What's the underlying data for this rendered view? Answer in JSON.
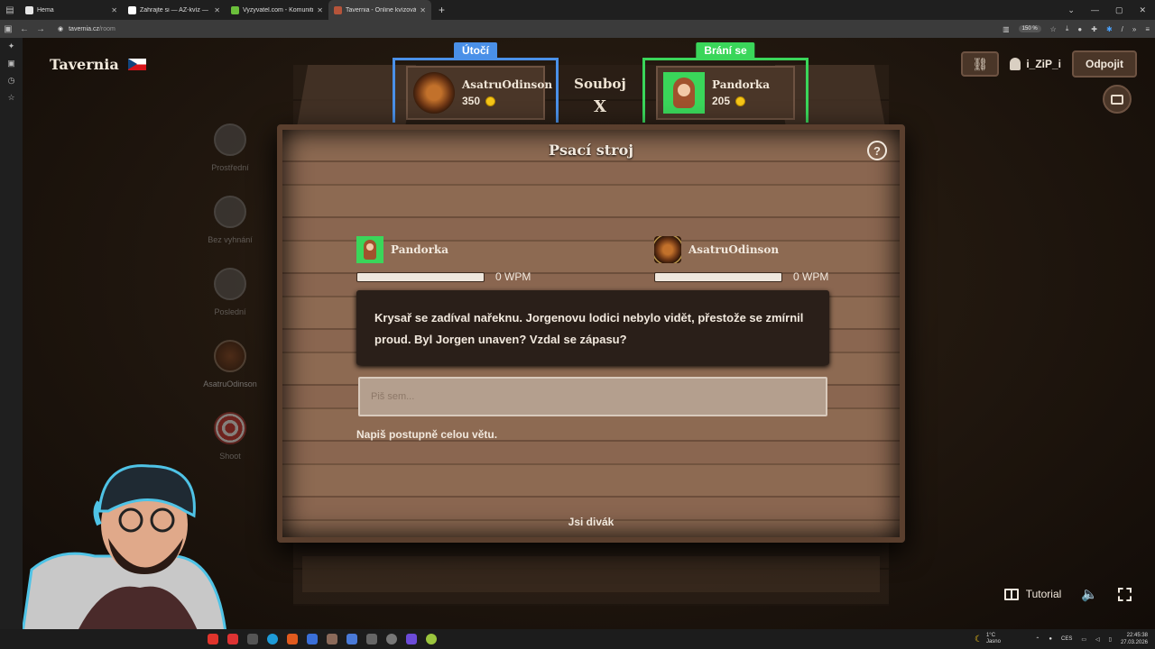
{
  "browser": {
    "tabs": [
      {
        "title": "Hema",
        "color": "#e6e6e6",
        "active": false
      },
      {
        "title": "Zahrajte si — AZ-kvíz — Český",
        "color": "#ffffff",
        "active": false
      },
      {
        "title": "Vyzyvatel.com - Komunitní věd",
        "color": "#6bbf3b",
        "active": false
      },
      {
        "title": "Tavernia - Online kvízová h",
        "color": "#b5543a",
        "active": true
      }
    ],
    "url_host": "tavernia.cz",
    "url_path": "/room",
    "zoom": "150 %"
  },
  "site": {
    "logo": "Tavernia",
    "flag": "czech-flag"
  },
  "steps": [
    {
      "label": "Prostřední",
      "state": "past"
    },
    {
      "label": "Bez vyhnání",
      "state": "past"
    },
    {
      "label": "Poslední",
      "state": "past"
    },
    {
      "label": "AsatruOdinson",
      "state": "current"
    },
    {
      "label": "Shoot",
      "state": "upcoming"
    }
  ],
  "duel": {
    "attacker": {
      "badge": "Útočí",
      "name": "AsatruOdinson",
      "coins": "350"
    },
    "defender": {
      "badge": "Brání se",
      "name": "Pandorka",
      "coins": "205"
    },
    "title_top": "Souboj",
    "title_bottom": "X"
  },
  "board": {
    "title": "Psací stroj",
    "help_icon": "?",
    "racers": [
      {
        "name": "Pandorka",
        "wpm": "0 WPM",
        "progress": 0
      },
      {
        "name": "AsatruOdinson",
        "wpm": "0 WPM",
        "progress": 0
      }
    ],
    "sentence": "Krysař se zadíval nařeknu. Jorgenovu lodici nebylo vidět, přestože se zmírnil proud. Byl Jorgen unaven? Vzdal se zápasu?",
    "input_placeholder": "Piš sem...",
    "hint": "Napiš postupně celou větu.",
    "spectator": "Jsi divák"
  },
  "topright": {
    "link_icon": "⛓",
    "username": "i_ZiP_i",
    "logout": "Odpojit"
  },
  "bottom": {
    "tutorial": "Tutorial"
  },
  "taskbar": {
    "weather_temp": "1°C",
    "weather_desc": "Jasno",
    "lang": "CES",
    "time": "22:45:38",
    "date": "27.03.2026"
  }
}
